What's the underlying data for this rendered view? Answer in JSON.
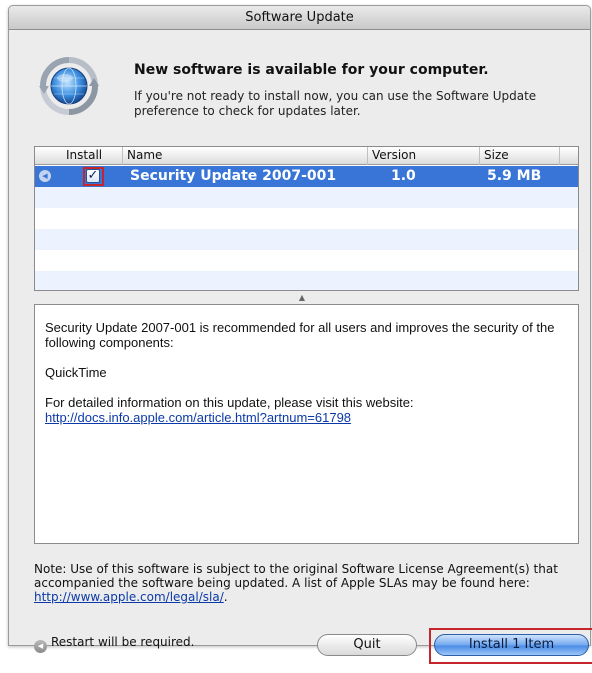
{
  "window": {
    "title": "Software Update"
  },
  "header": {
    "headline": "New software is available for your computer.",
    "subtext": "If you're not ready to install now, you can use the Software Update preference to check for updates later."
  },
  "table": {
    "columns": {
      "install": "Install",
      "name": "Name",
      "version": "Version",
      "size": "Size"
    },
    "rows": [
      {
        "install": true,
        "checkmark": "✓",
        "name": "Security Update 2007-001",
        "version": "1.0",
        "size": "5.9 MB",
        "selected": true
      }
    ]
  },
  "details": {
    "intro": "Security Update 2007-001 is recommended for all users and improves the security of the following components:",
    "component": "QuickTime",
    "more_info": "For detailed information on this update, please visit this website:",
    "link": "http://docs.info.apple.com/article.html?artnum=61798"
  },
  "footer": {
    "note_text": "Note: Use of this software is subject to the original Software License Agreement(s) that accompanied the software being updated. A list of Apple SLAs may be found here: ",
    "note_link": "http://www.apple.com/legal/sla/",
    "note_end": ".",
    "restart_text": "Restart will be required."
  },
  "buttons": {
    "quit": "Quit",
    "install": "Install 1 Item"
  },
  "colors": {
    "selection": "#3875d7",
    "highlight_box": "#c4262b",
    "link": "#0b3aa8"
  },
  "icons": {
    "app": "software-update-globe-icon",
    "restart": "restart-icon",
    "disclosure": "disclosure-triangle-icon"
  }
}
